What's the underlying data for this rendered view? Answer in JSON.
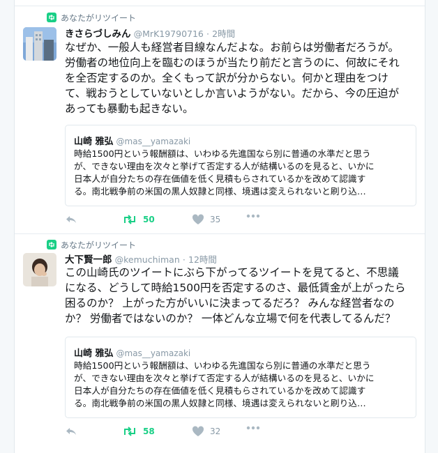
{
  "colors": {
    "retweet_green": "#19cf86",
    "muted": "#8899a6",
    "border": "#e1e8ed"
  },
  "tweets": [
    {
      "context": "あなたがリツイート",
      "name": "きさらづしみん",
      "handle": "@MrK19790716",
      "dot": "·",
      "time": "2時間",
      "text": "なぜか、一般人も経営者目線なんだよな。お前らは労働者だろうが。\n労働者の地位向上を臨むのほうが当たり前だと言うのに、何故にそれ\nを全否定するのか。全くもって訳が分からない。何かと理由をつけ\nて、戦おうとしていないとしか言いようがない。だから、今の圧迫が\nあっても暴動も起きない。",
      "quote": {
        "name": "山崎 雅弘",
        "handle": "@mas__yamazaki",
        "text": "時給1500円という報酬額は、いわゆる先進国なら別に普通の水準だと思う\nが、できない理由を次々と挙げて否定する人が結構いるのを見ると、いかに\n日本人が自分たちの存在価値を低く見積もらされているかを改めて認識す\nる。南北戦争前の米国の黒人奴隷と同様、境遇は変えられないと刷り込…"
      },
      "retweets": "50",
      "likes": "35",
      "icons": [
        "reply-icon",
        "retweet-icon",
        "like-icon",
        "more-icon"
      ]
    },
    {
      "context": "あなたがリツイート",
      "name": "大下賢一郎",
      "handle": "@kemuchiman",
      "dot": "·",
      "time": "12時間",
      "text": "この山崎氏のツイートにぶら下がってるツイートを見てると、不思議\nになる、どうして時給1500円を否定するのさ、最低賃金が上がったら\n困るのか？ 上がった方がいいに決まってるだろ？ みんな経営者なの\nか？ 労働者ではないのか？ 一体どんな立場で何を代表してるんだ？",
      "quote": {
        "name": "山崎 雅弘",
        "handle": "@mas__yamazaki",
        "text": "時給1500円という報酬額は、いわゆる先進国なら別に普通の水準だと思う\nが、できない理由を次々と挙げて否定する人が結構いるのを見ると、いかに\n日本人が自分たちの存在価値を低く見積もらされているかを改めて認識す\nる。南北戦争前の米国の黒人奴隷と同様、境遇は変えられないと刷り込…"
      },
      "retweets": "58",
      "likes": "32",
      "icons": [
        "reply-icon",
        "retweet-icon",
        "like-icon",
        "more-icon"
      ]
    }
  ]
}
